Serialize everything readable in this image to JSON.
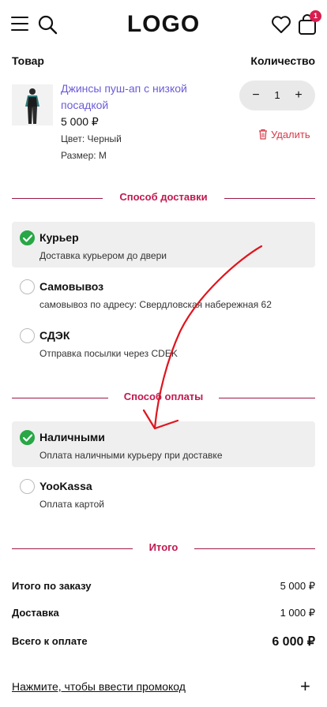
{
  "header": {
    "logo": "LOGO",
    "cart_count": "1",
    "icons": [
      "menu-icon",
      "search-icon",
      "heart-icon",
      "bag-icon"
    ]
  },
  "cart": {
    "col_product": "Товар",
    "col_quantity": "Количество",
    "item": {
      "name": "Джинсы пуш-ап с низкой посадкой",
      "price": "5 000 ₽",
      "color": "Цвет: Черный",
      "size": "Размер: M",
      "quantity": "1",
      "delete_label": "Удалить"
    }
  },
  "delivery": {
    "title": "Способ доставки",
    "options": [
      {
        "title": "Курьер",
        "desc": "Доставка курьером до двери",
        "selected": true
      },
      {
        "title": "Самовывоз",
        "desc": "самовывоз по адресу: Свердловская набережная 62",
        "selected": false
      },
      {
        "title": "СДЭК",
        "desc": "Отправка посылки через CDEK",
        "selected": false
      }
    ]
  },
  "payment": {
    "title": "Способ оплаты",
    "options": [
      {
        "title": "Наличными",
        "desc": "Оплата наличными курьеру при доставке",
        "selected": true
      },
      {
        "title": "YooKassa",
        "desc": "Оплата картой",
        "selected": false
      }
    ]
  },
  "summary": {
    "title": "Итого",
    "order_label": "Итого по заказу",
    "order_value": "5 000 ₽",
    "delivery_label": "Доставка",
    "delivery_value": "1 000 ₽",
    "total_label": "Всего к оплате",
    "total_value": "6 000 ₽"
  },
  "promo": {
    "label": "Нажмите, чтобы ввести промокод",
    "plus": "+"
  },
  "colors": {
    "accent": "#c1194f",
    "link": "#6b5cd6",
    "selected": "#27a745",
    "danger": "#d83a4a",
    "annotation": "#e0141e"
  }
}
